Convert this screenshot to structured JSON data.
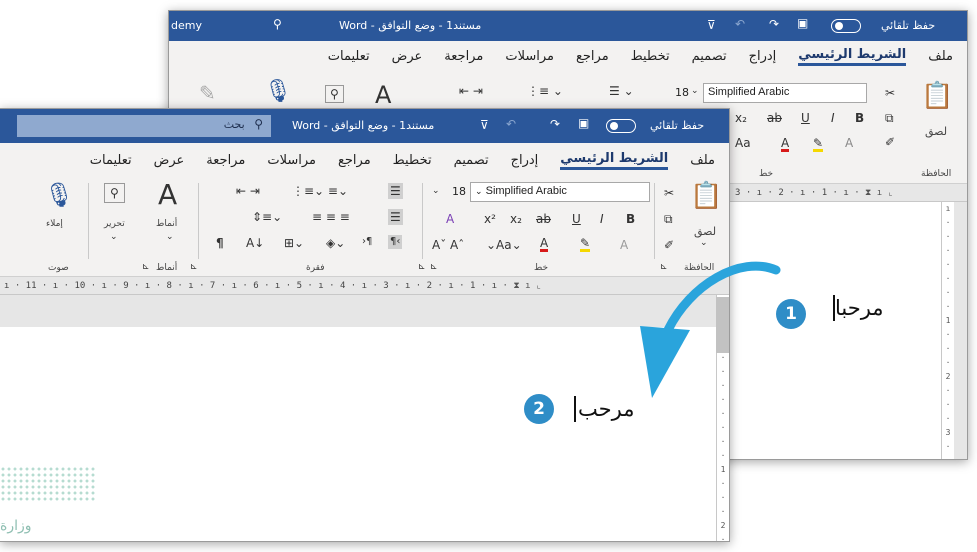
{
  "back_window": {
    "title_left": "demy",
    "doc_title": "مستند1  -  وضع التوافق  -  Word",
    "autosave": "حفظ تلقائي",
    "tabs": [
      "ملف",
      "الشريط الرئيسي",
      "إدراج",
      "تصميم",
      "تخطيط",
      "مراجع",
      "مراسلات",
      "مراجعة",
      "عرض",
      "تعليمات"
    ],
    "active_tab": "الشريط الرئيسي",
    "font_name": "Simplified Arabic",
    "font_size": "18",
    "paste": "لصق",
    "clipboard_group": "الحافظة",
    "font_group": "خط",
    "ruler": "3 · ı · 2 · ı · 1 · ı ·",
    "text": "مرحبا",
    "step": "1"
  },
  "front_window": {
    "search_placeholder": "بحث",
    "doc_title": "مستند1  -  وضع التوافق  -  Word",
    "autosave": "حفظ تلقائي",
    "tabs": [
      "ملف",
      "الشريط الرئيسي",
      "إدراج",
      "تصميم",
      "تخطيط",
      "مراجع",
      "مراسلات",
      "مراجعة",
      "عرض",
      "تعليمات"
    ],
    "active_tab": "الشريط الرئيسي",
    "font_name": "Simplified Arabic",
    "font_size": "18",
    "paste": "لصق",
    "clipboard_group": "الحافظة",
    "font_group": "خط",
    "paragraph_group": "فقرة",
    "styles_group": "أنماط",
    "styles_label": "أنماط",
    "edit_label": "تحرير",
    "dictate_label": "إملاء",
    "voice_group": "صوت",
    "ruler": "ı · 11 · ı · 10 · ı · 9 · ı · 8 · ı · 7 · ı · 6 · ı · 5 · ı · 4 · ı · 3 · ı · 2 · ı · 1 · ı ·",
    "text": "مرحب",
    "step": "2"
  },
  "watermark": "وزارة",
  "colors": {
    "title_bar": "#2b579a",
    "badge": "#2f8dc7",
    "arrow": "#2aa4dc",
    "search_box": "#8fa9cf"
  }
}
